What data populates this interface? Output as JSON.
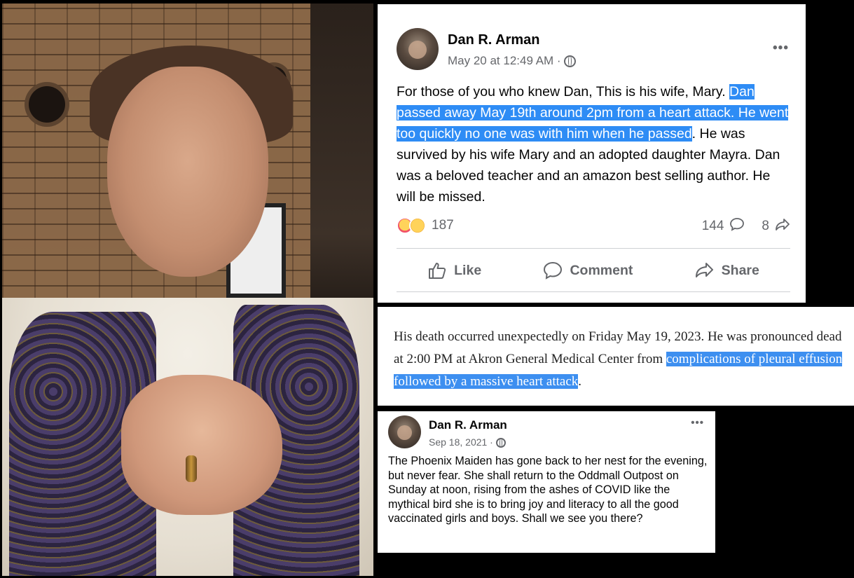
{
  "post1": {
    "author": "Dan R. Arman",
    "timestamp": "May 20 at 12:49 AM ·",
    "visibility_icon": "globe-icon",
    "more_icon": "•••",
    "text_before": "For those of you who knew Dan, This is his wife, Mary. ",
    "text_highlight": "Dan passed away May 19th around 2pm from a heart attack. He went too quickly no one was with him when he passed",
    "text_after": ". He was survived by his wife Mary and an adopted daughter Mayra. Dan was a beloved teacher and an amazon best selling author. He will be missed.",
    "reaction_icons": [
      "care-emoji-icon",
      "sad-emoji-icon"
    ],
    "reaction_count": "187",
    "comment_count": "144",
    "share_count": "8",
    "actions": {
      "like": "Like",
      "comment": "Comment",
      "share": "Share"
    },
    "highlight_color": "#2e8cf5"
  },
  "obituary": {
    "text_before": "His death occurred unexpectedly on Friday May 19, 2023. He was pronounced dead at 2:00 PM at Akron General Medical Center from ",
    "text_highlight": "complications of pleural effusion followed by a massive heart attack",
    "text_after": "."
  },
  "post2": {
    "author": "Dan R. Arman",
    "timestamp": "Sep 18, 2021 ·",
    "visibility_icon": "globe-icon",
    "more_icon": "•••",
    "text": "The Phoenix Maiden has gone back to her nest for the evening, but never fear. She shall return to the Oddmall Outpost on Sunday at noon, rising from the ashes of COVID like the mythical bird she is to bring joy and literacy to all the good vaccinated girls and boys. Shall we see you there?"
  }
}
